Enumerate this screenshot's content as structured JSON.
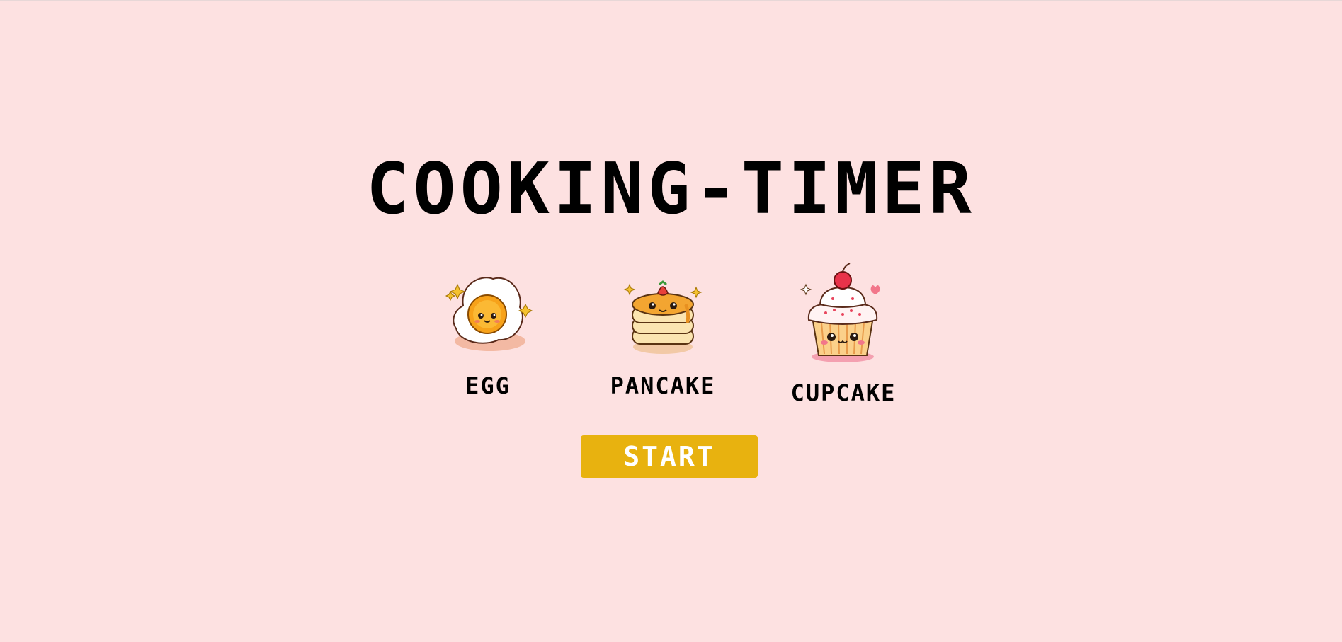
{
  "title": "COOKING-TIMER",
  "foods": [
    {
      "label": "EGG",
      "icon": "fried-egg-icon"
    },
    {
      "label": "PANCAKE",
      "icon": "pancake-stack-icon"
    },
    {
      "label": "CUPCAKE",
      "icon": "cupcake-icon"
    }
  ],
  "start_label": "START",
  "colors": {
    "background": "#fde1e1",
    "button": "#e8b20f",
    "button_text": "#ffffff",
    "text": "#000000"
  }
}
